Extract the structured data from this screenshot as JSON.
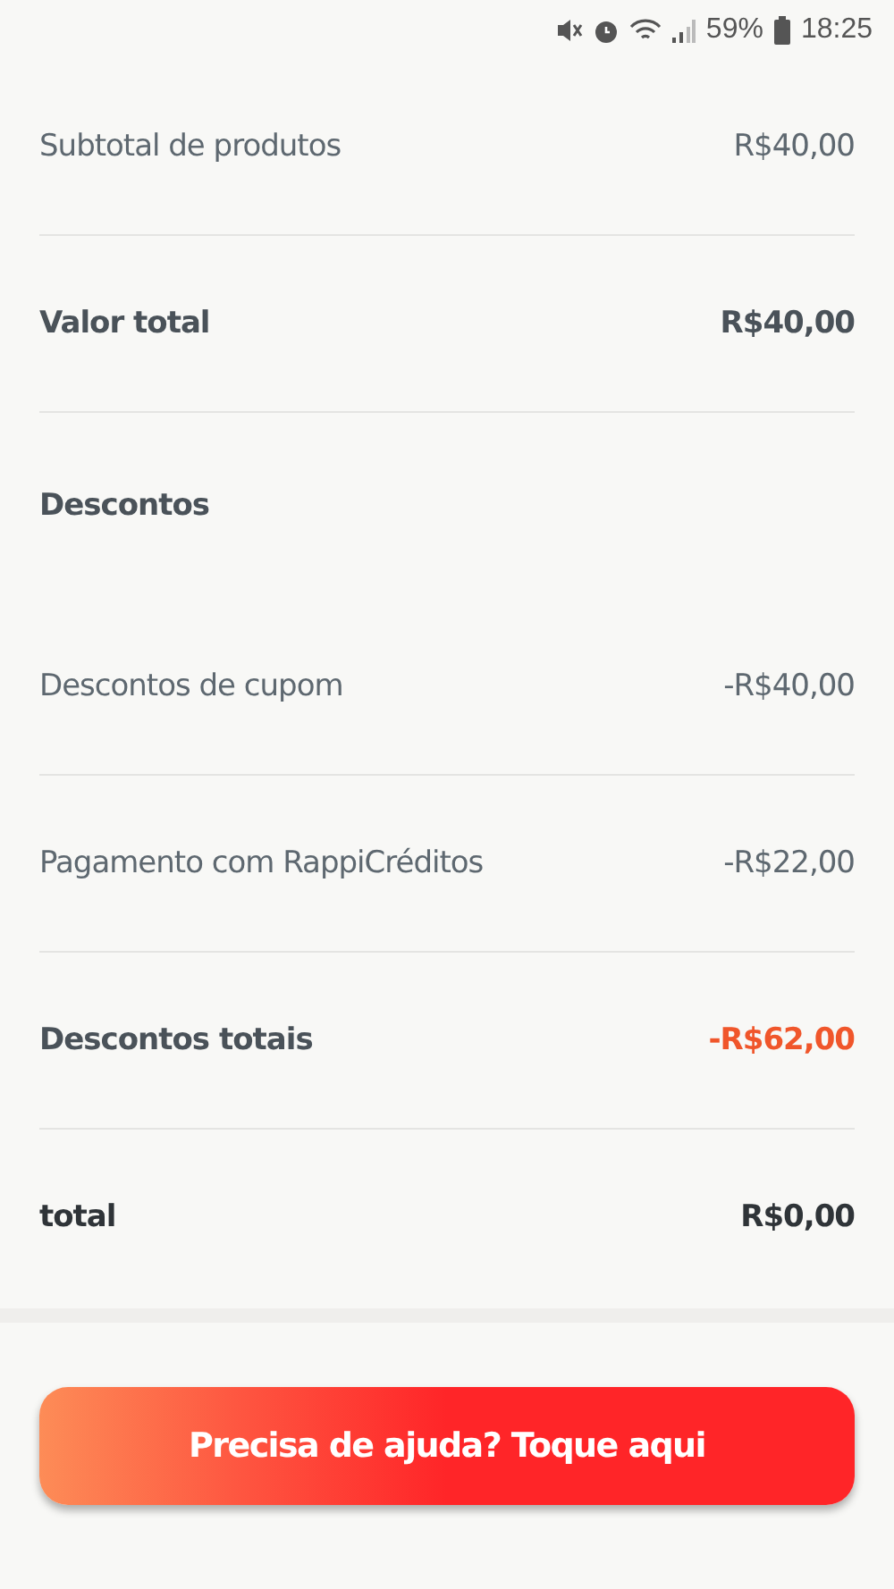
{
  "status_bar": {
    "battery": "59%",
    "time": "18:25"
  },
  "rows": [
    {
      "kind": "regular",
      "label": "Subtotal de produtos",
      "value": "R$40,00"
    },
    {
      "kind": "bold",
      "label": "Valor total",
      "value": "R$40,00"
    },
    {
      "kind": "heading",
      "label": "Descontos"
    },
    {
      "kind": "regular",
      "label": "Descontos de cupom",
      "value": "-R$40,00"
    },
    {
      "kind": "regular",
      "label": "Pagamento com RappiCréditos",
      "value": "-R$22,00"
    },
    {
      "kind": "accent",
      "label": "Descontos totais",
      "value": "-R$62,00"
    },
    {
      "kind": "total",
      "label": "total",
      "value": "R$0,00"
    }
  ],
  "help_button": {
    "label": "Precisa de ajuda? Toque aqui"
  }
}
